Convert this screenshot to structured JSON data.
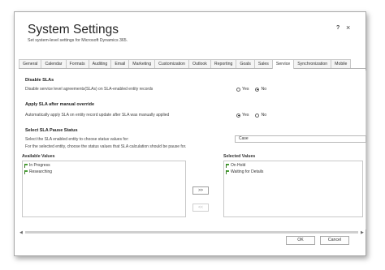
{
  "dialog": {
    "title": "System Settings",
    "subtitle": "Set system-level settings for Microsoft Dynamics 365.",
    "help_label": "?",
    "close_label": "×"
  },
  "tabs": [
    "General",
    "Calendar",
    "Formats",
    "Auditing",
    "Email",
    "Marketing",
    "Customization",
    "Outlook",
    "Reporting",
    "Goals",
    "Sales",
    "Service",
    "Synchronization",
    "Mobile"
  ],
  "active_tab": "Service",
  "sections": {
    "disable_slas": {
      "heading": "Disable SLAs",
      "description": "Disable service level agreements(SLAs) on SLA-enabled entity records",
      "yes_label": "Yes",
      "no_label": "No",
      "selected": "No"
    },
    "apply_sla_override": {
      "heading": "Apply SLA after manual override",
      "description": "Automatically apply SLA on entity record update after SLA was manually applied",
      "yes_label": "Yes",
      "no_label": "No",
      "selected": "Yes"
    },
    "pause_status": {
      "heading": "Select SLA Pause Status",
      "entity_prompt": "Select the SLA enabled entity to choose status values for:",
      "entity_value": "Case",
      "status_prompt": "For the selected entity, choose the status values that SLA calculation should be pause for.",
      "available_label": "Available Values",
      "available_items": [
        "In Progress",
        "Researching"
      ],
      "selected_label": "Selected Values",
      "selected_items": [
        "On Hold",
        "Waiting for Details"
      ],
      "add_label": ">>",
      "remove_label": "<<"
    }
  },
  "footer": {
    "ok_label": "OK",
    "cancel_label": "Cancel"
  },
  "colors": {
    "flag_green": "#4aa336",
    "border": "#a8a8a8"
  }
}
